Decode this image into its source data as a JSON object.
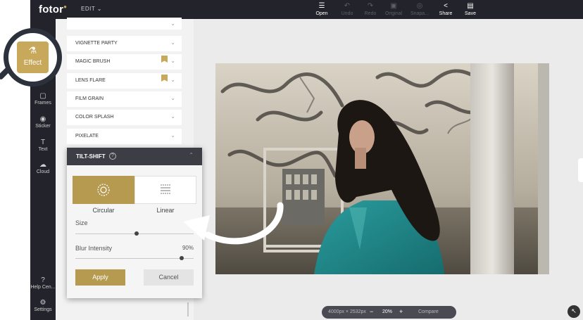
{
  "app": {
    "logo": "fotor",
    "edit_menu": "EDIT ⌄"
  },
  "toolbar": {
    "open": "Open",
    "undo": "Undo",
    "redo": "Redo",
    "original": "Original",
    "snapshot": "Snapa...",
    "share": "Share",
    "save": "Save"
  },
  "leftnav": {
    "effect": "Effect",
    "frames": "Frames",
    "sticker": "Sticker",
    "text": "Text",
    "cloud": "Cloud",
    "help": "Help Cen...",
    "settings": "Settings"
  },
  "effects": {
    "items": [
      "VIGNETTE PARTY",
      "MAGIC BRUSH",
      "LENS FLARE",
      "FILM GRAIN",
      "COLOR SPLASH",
      "PIXELATE"
    ]
  },
  "tilt_shift": {
    "title": "TILT-SHIFT",
    "modes": [
      "Circular",
      "Linear"
    ],
    "active_mode": "Circular",
    "size_label": "Size",
    "size_value": 0.52,
    "blur_label": "Blur Intensity",
    "blur_value": "90%",
    "apply_label": "Apply",
    "cancel_label": "Cancel"
  },
  "canvas": {
    "dimensions": "4000px × 2532px",
    "zoom": "20%",
    "compare_label": "Compare"
  },
  "colors": {
    "accent": "#b59a50",
    "topbar": "#23232b",
    "panel_header": "#3d3d45",
    "teal_jacket": "#1f8a8c"
  }
}
